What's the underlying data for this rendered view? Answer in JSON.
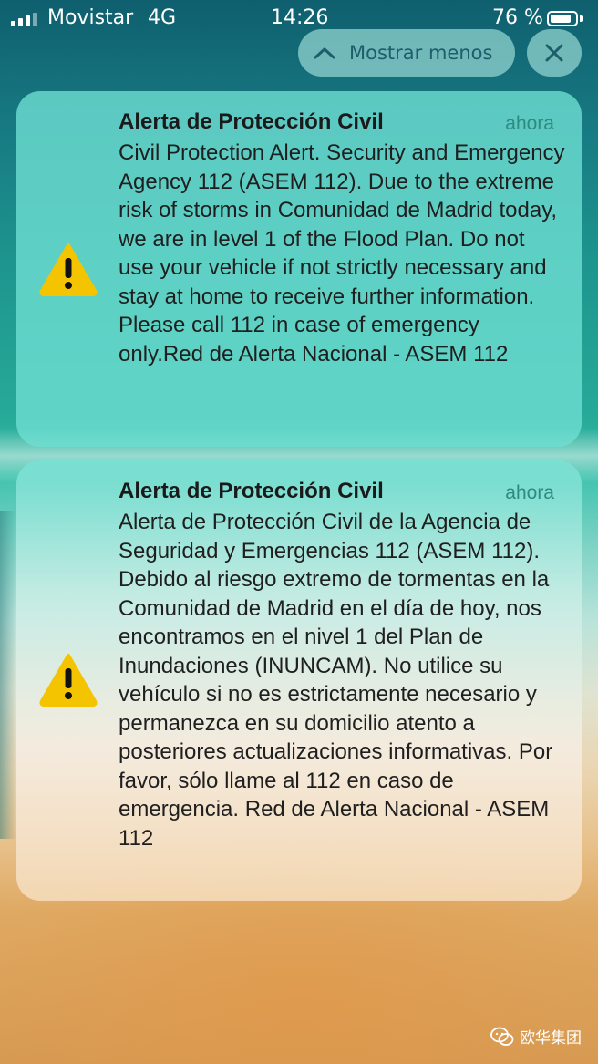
{
  "status_bar": {
    "carrier": "Movistar",
    "network": "4G",
    "time": "14:26",
    "battery_percent": "76 %"
  },
  "controls": {
    "show_less_label": "Mostrar menos",
    "show_less_icon": "chevron-up-icon",
    "close_icon": "close-icon"
  },
  "notifications": [
    {
      "icon": "warning-icon",
      "title": "Alerta de Protección Civil",
      "time": "ahora",
      "body": "Civil Protection Alert. Security and Emergency Agency 112 (ASEM 112). Due to the extreme risk of storms in Comunidad de Madrid today, we are in level 1 of the Flood Plan. Do not use your vehicle if not strictly necessary and stay at home to receive further information. Please call 112 in case of emergency only.Red de Alerta Nacional - ASEM 112"
    },
    {
      "icon": "warning-icon",
      "title": "Alerta de Protección Civil",
      "time": "ahora",
      "body": "Alerta de Protección Civil de la Agencia de Seguridad y Emergencias 112 (ASEM 112). Debido al riesgo extremo de tormentas en la Comunidad de Madrid en el día de hoy, nos encontramos en el nivel 1 del Plan de Inundaciones (INUNCAM). No utilice su vehículo si no es estrictamente necesario y permanezca en su domicilio atento a posteriores actualizaciones informativas. Por favor, sólo llame al 112 en caso de emergencia. Red de Alerta Nacional - ASEM 112"
    }
  ],
  "watermark": {
    "icon": "wechat-icon",
    "text": "欧华集团"
  },
  "colors": {
    "warning_yellow": "#f5c400",
    "time_green": "#2f8a7e",
    "pill_text": "#1d5e6a"
  }
}
